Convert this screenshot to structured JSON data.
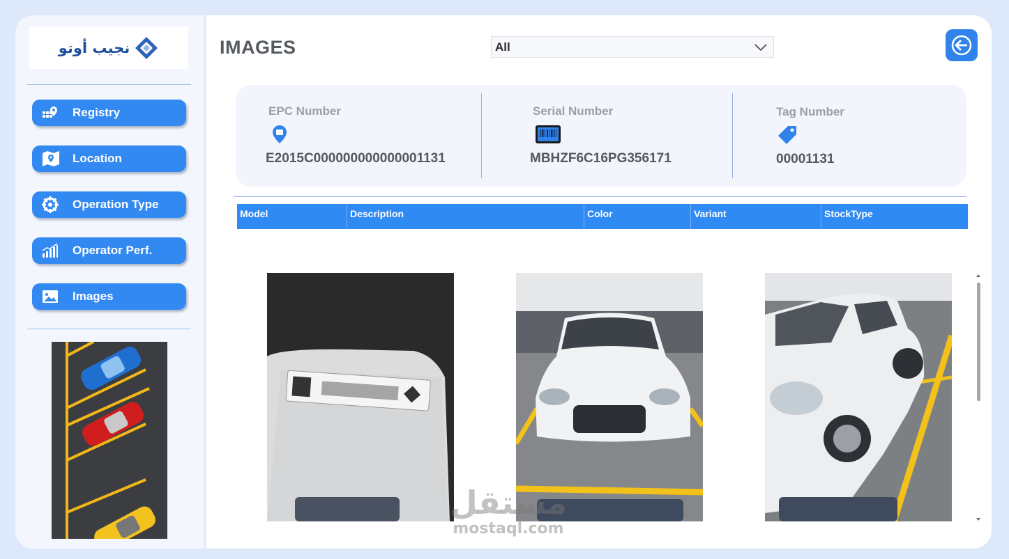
{
  "app": {
    "logo_text": "نجيب أوتو"
  },
  "sidebar": {
    "items": [
      {
        "label": "Registry",
        "icon": "registry-icon"
      },
      {
        "label": "Location",
        "icon": "map-pin-icon"
      },
      {
        "label": "Operation Type",
        "icon": "gear-wheel-icon"
      },
      {
        "label": "Operator Perf.",
        "icon": "bar-chart-icon"
      },
      {
        "label": "Images",
        "icon": "image-icon"
      }
    ]
  },
  "header": {
    "title": "IMAGES",
    "filter_value": "All"
  },
  "kpis": [
    {
      "label": "EPC Number",
      "value": "E2015C000000000000001131",
      "icon": "location-pin-icon"
    },
    {
      "label": "Serial Number",
      "value": "MBHZF6C16PG356171",
      "icon": "barcode-icon"
    },
    {
      "label": "Tag Number",
      "value": "00001131",
      "icon": "tag-icon"
    }
  ],
  "table": {
    "columns": [
      "Model",
      "Description",
      "Color",
      "Variant",
      "StockType"
    ]
  },
  "watermark": {
    "arabic": "مستقل",
    "latin": "mostaql.com"
  },
  "colors": {
    "accent": "#3289f1",
    "background": "#dde8fb",
    "header_blue": "#2f8af3"
  }
}
